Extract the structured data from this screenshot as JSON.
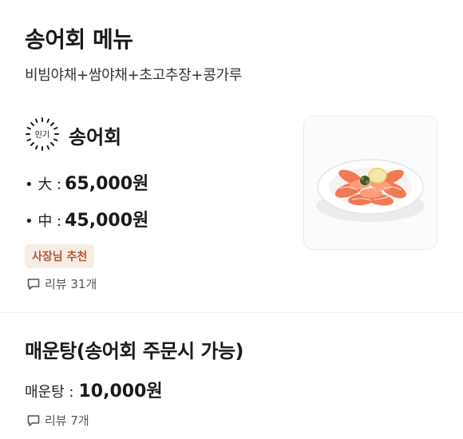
{
  "header": {
    "title": "송어회 메뉴",
    "subtitle": "비빔야채+쌈야채+초고추장+콩가루"
  },
  "menu_items": [
    {
      "badge": "인기",
      "name": "송어회",
      "prices": [
        {
          "size": "• 大 :",
          "price": "65,000원"
        },
        {
          "size": "• 中 :",
          "price": "45,000원"
        }
      ],
      "tag": "사장님 추천",
      "review": "리뷰 31개"
    },
    {
      "name": "매운탕(송어회 주문시 가능)",
      "prices": [
        {
          "size": "매운탕 :",
          "price": "10,000원"
        }
      ],
      "review": "리뷰 7개"
    }
  ],
  "icons": {
    "popular": "sunburst-badge-icon",
    "review": "speech-bubble-icon",
    "photo": "sashimi-plate-image"
  },
  "colors": {
    "tag_bg": "#f8ece6",
    "tag_text": "#b35a33",
    "divider": "#eeeeee"
  }
}
